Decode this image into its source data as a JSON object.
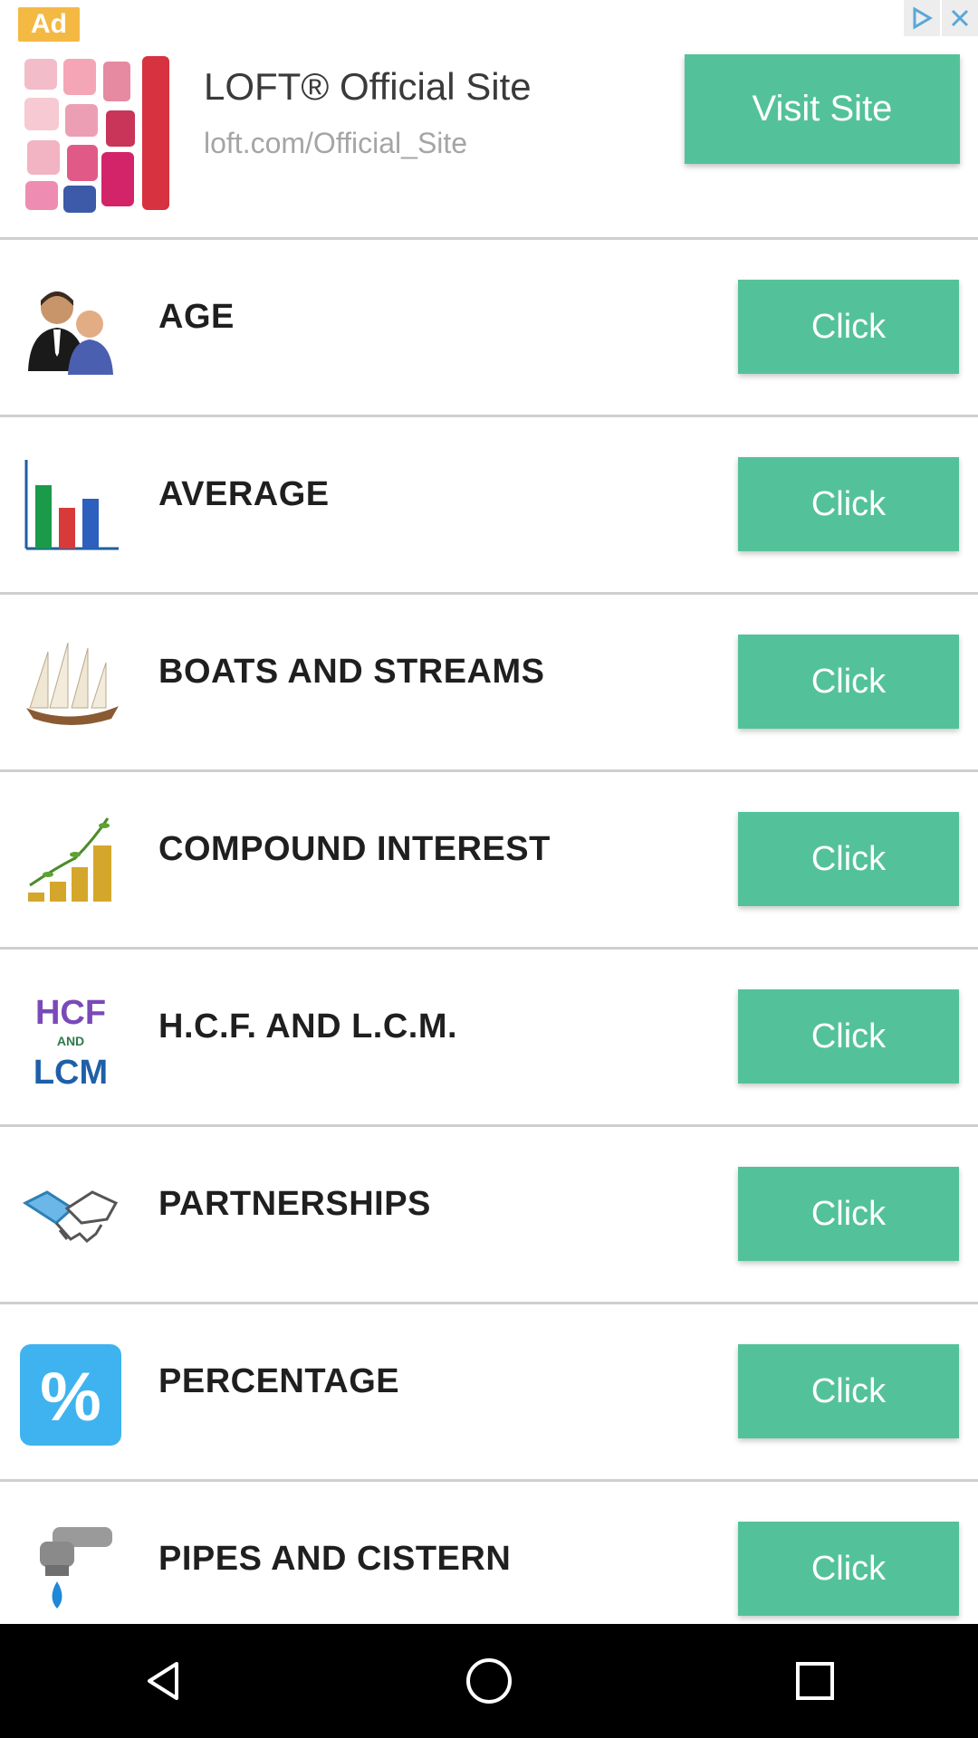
{
  "ad": {
    "badge": "Ad",
    "title": "LOFT® Official Site",
    "url": "loft.com/Official_Site",
    "cta": "Visit Site",
    "thumb_icon": "clothing-collage-icon",
    "adchoices_icon": "adchoices-icon",
    "close_icon": "close-icon"
  },
  "items": [
    {
      "label": "AGE",
      "button": "Click",
      "icon": "people-icon"
    },
    {
      "label": "AVERAGE",
      "button": "Click",
      "icon": "bar-chart-icon"
    },
    {
      "label": "BOATS AND STREAMS",
      "button": "Click",
      "icon": "boat-icon"
    },
    {
      "label": "COMPOUND INTEREST",
      "button": "Click",
      "icon": "coins-growth-icon"
    },
    {
      "label": "H.C.F. AND L.C.M.",
      "button": "Click",
      "icon": "hcf-lcm-icon",
      "icon_text_top": "HCF",
      "icon_text_mid": "AND",
      "icon_text_bottom": "LCM"
    },
    {
      "label": "PARTNERSHIPS",
      "button": "Click",
      "icon": "handshake-icon"
    },
    {
      "label": "PERCENTAGE",
      "button": "Click",
      "icon": "percent-icon",
      "icon_text": "%"
    },
    {
      "label": "PIPES AND CISTERN",
      "button": "Click",
      "icon": "tap-icon"
    }
  ],
  "colors": {
    "accent": "#53c29a",
    "ad_badge": "#f4b942",
    "divider": "#cfcfcf",
    "navbar": "#000000"
  },
  "navbar": {
    "back_icon": "back-icon",
    "home_icon": "home-icon",
    "recents_icon": "recents-icon"
  }
}
